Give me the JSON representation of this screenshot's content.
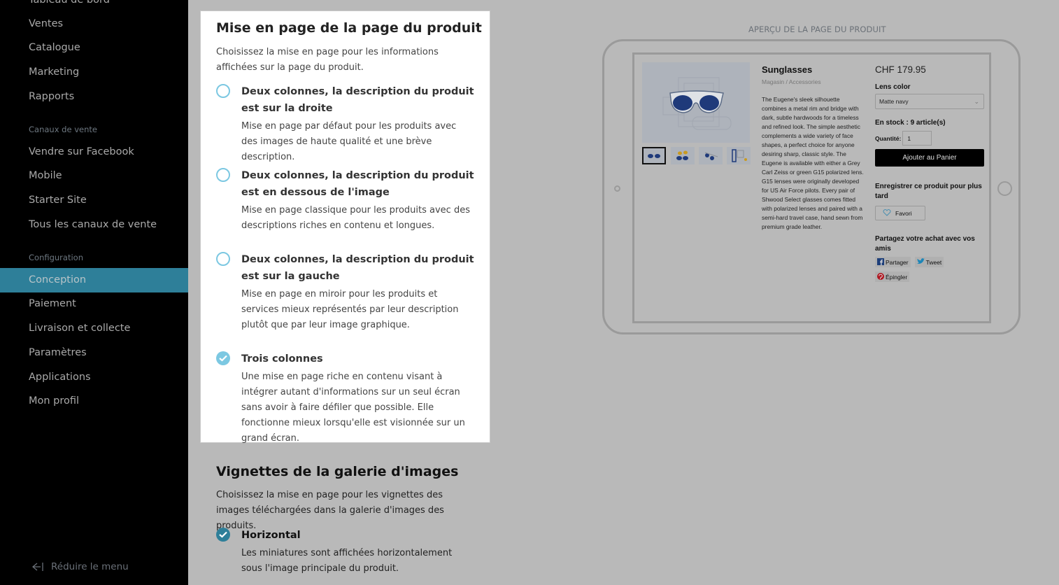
{
  "sidebar": {
    "top_item": "Tableau de bord",
    "items": [
      {
        "label": "Ventes"
      },
      {
        "label": "Catalogue"
      },
      {
        "label": "Marketing"
      },
      {
        "label": "Rapports"
      }
    ],
    "section_channels": "Canaux de vente",
    "channels": [
      {
        "label": "Vendre sur Facebook"
      },
      {
        "label": "Mobile"
      },
      {
        "label": "Starter Site"
      },
      {
        "label": "Tous les canaux de vente"
      }
    ],
    "section_config": "Configuration",
    "config": [
      {
        "label": "Conception",
        "active": true
      },
      {
        "label": "Paiement"
      },
      {
        "label": "Livraison et collecte"
      },
      {
        "label": "Paramètres"
      },
      {
        "label": "Applications"
      },
      {
        "label": "Mon profil"
      }
    ],
    "collapse_label": "Réduire le menu",
    "active_color": "#2e7f99"
  },
  "layout_panel": {
    "title": "Mise en page de la page du produit",
    "description": "Choisissez la mise en page pour les informations affichées sur la page du produit.",
    "options": [
      {
        "title": "Deux colonnes, la description du produit est sur la droite",
        "description": "Mise en page par défaut pour les produits avec des images de haute qualité et une brève description.",
        "selected": false
      },
      {
        "title": "Deux colonnes, la description du produit est en dessous de l'image",
        "description": "Mise en page classique pour les produits avec des descriptions riches en contenu et longues.",
        "selected": false
      },
      {
        "title": "Deux colonnes, la description du produit est sur la gauche",
        "description": "Mise en page en miroir pour les produits et services mieux représentés par leur description plutôt que par leur image graphique.",
        "selected": false
      },
      {
        "title": "Trois colonnes",
        "description": "Une mise en page riche en contenu visant à intégrer autant d'informations sur un seul écran sans avoir à faire défiler que possible. Elle fonctionne mieux lorsqu'elle est visionnée sur un grand écran.",
        "selected": true
      }
    ],
    "radio_color": "#7cc8e2"
  },
  "gallery_section": {
    "title": "Vignettes de la galerie d'images",
    "description": "Choisissez la mise en page pour les vignettes des images téléchargées dans la galerie d'images des produits.",
    "option": {
      "title": "Horizontal",
      "description": "Les miniatures sont affichées horizontalement sous l'image principale du produit.",
      "selected": true
    }
  },
  "preview": {
    "label": "APERÇU DE LA PAGE DU PRODUIT",
    "product": {
      "name": "Sunglasses",
      "breadcrumb": "Magasin  /  Accessories",
      "description": "The Eugene's sleek silhouette combines a metal rim and bridge with dark, subtle hardwoods for a timeless and refined look. The simple aesthetic complements a wide variety of face shapes, a perfect choice for anyone desiring sharp, classic style. The Eugene is available with either a Grey Carl Zeiss or green G15 polarized lens. G15 lenses were originally developed for US Air Force pilots. Every pair of Shwood Select glasses comes fitted with polarized lenses and paired with a semi-hard travel case, hand sewn from premium grade leather.",
      "price": "CHF 179.95",
      "option_label": "Lens color",
      "option_value": "Matte navy",
      "stock": "En stock : 9 article(s)",
      "quantity_label": "Quantité:",
      "quantity_value": "1",
      "add_to_cart": "Ajouter au Panier",
      "save_label": "Enregistrer ce produit pour plus tard",
      "favorite_label": "Favori",
      "share_label": "Partagez votre achat avec vos amis",
      "share_buttons": [
        {
          "label": "Partager",
          "icon": "facebook-icon"
        },
        {
          "label": "Tweet",
          "icon": "twitter-icon"
        },
        {
          "label": "Épingler",
          "icon": "pinterest-icon"
        }
      ],
      "thumbnails": [
        "front",
        "colors",
        "side",
        "case"
      ]
    }
  }
}
